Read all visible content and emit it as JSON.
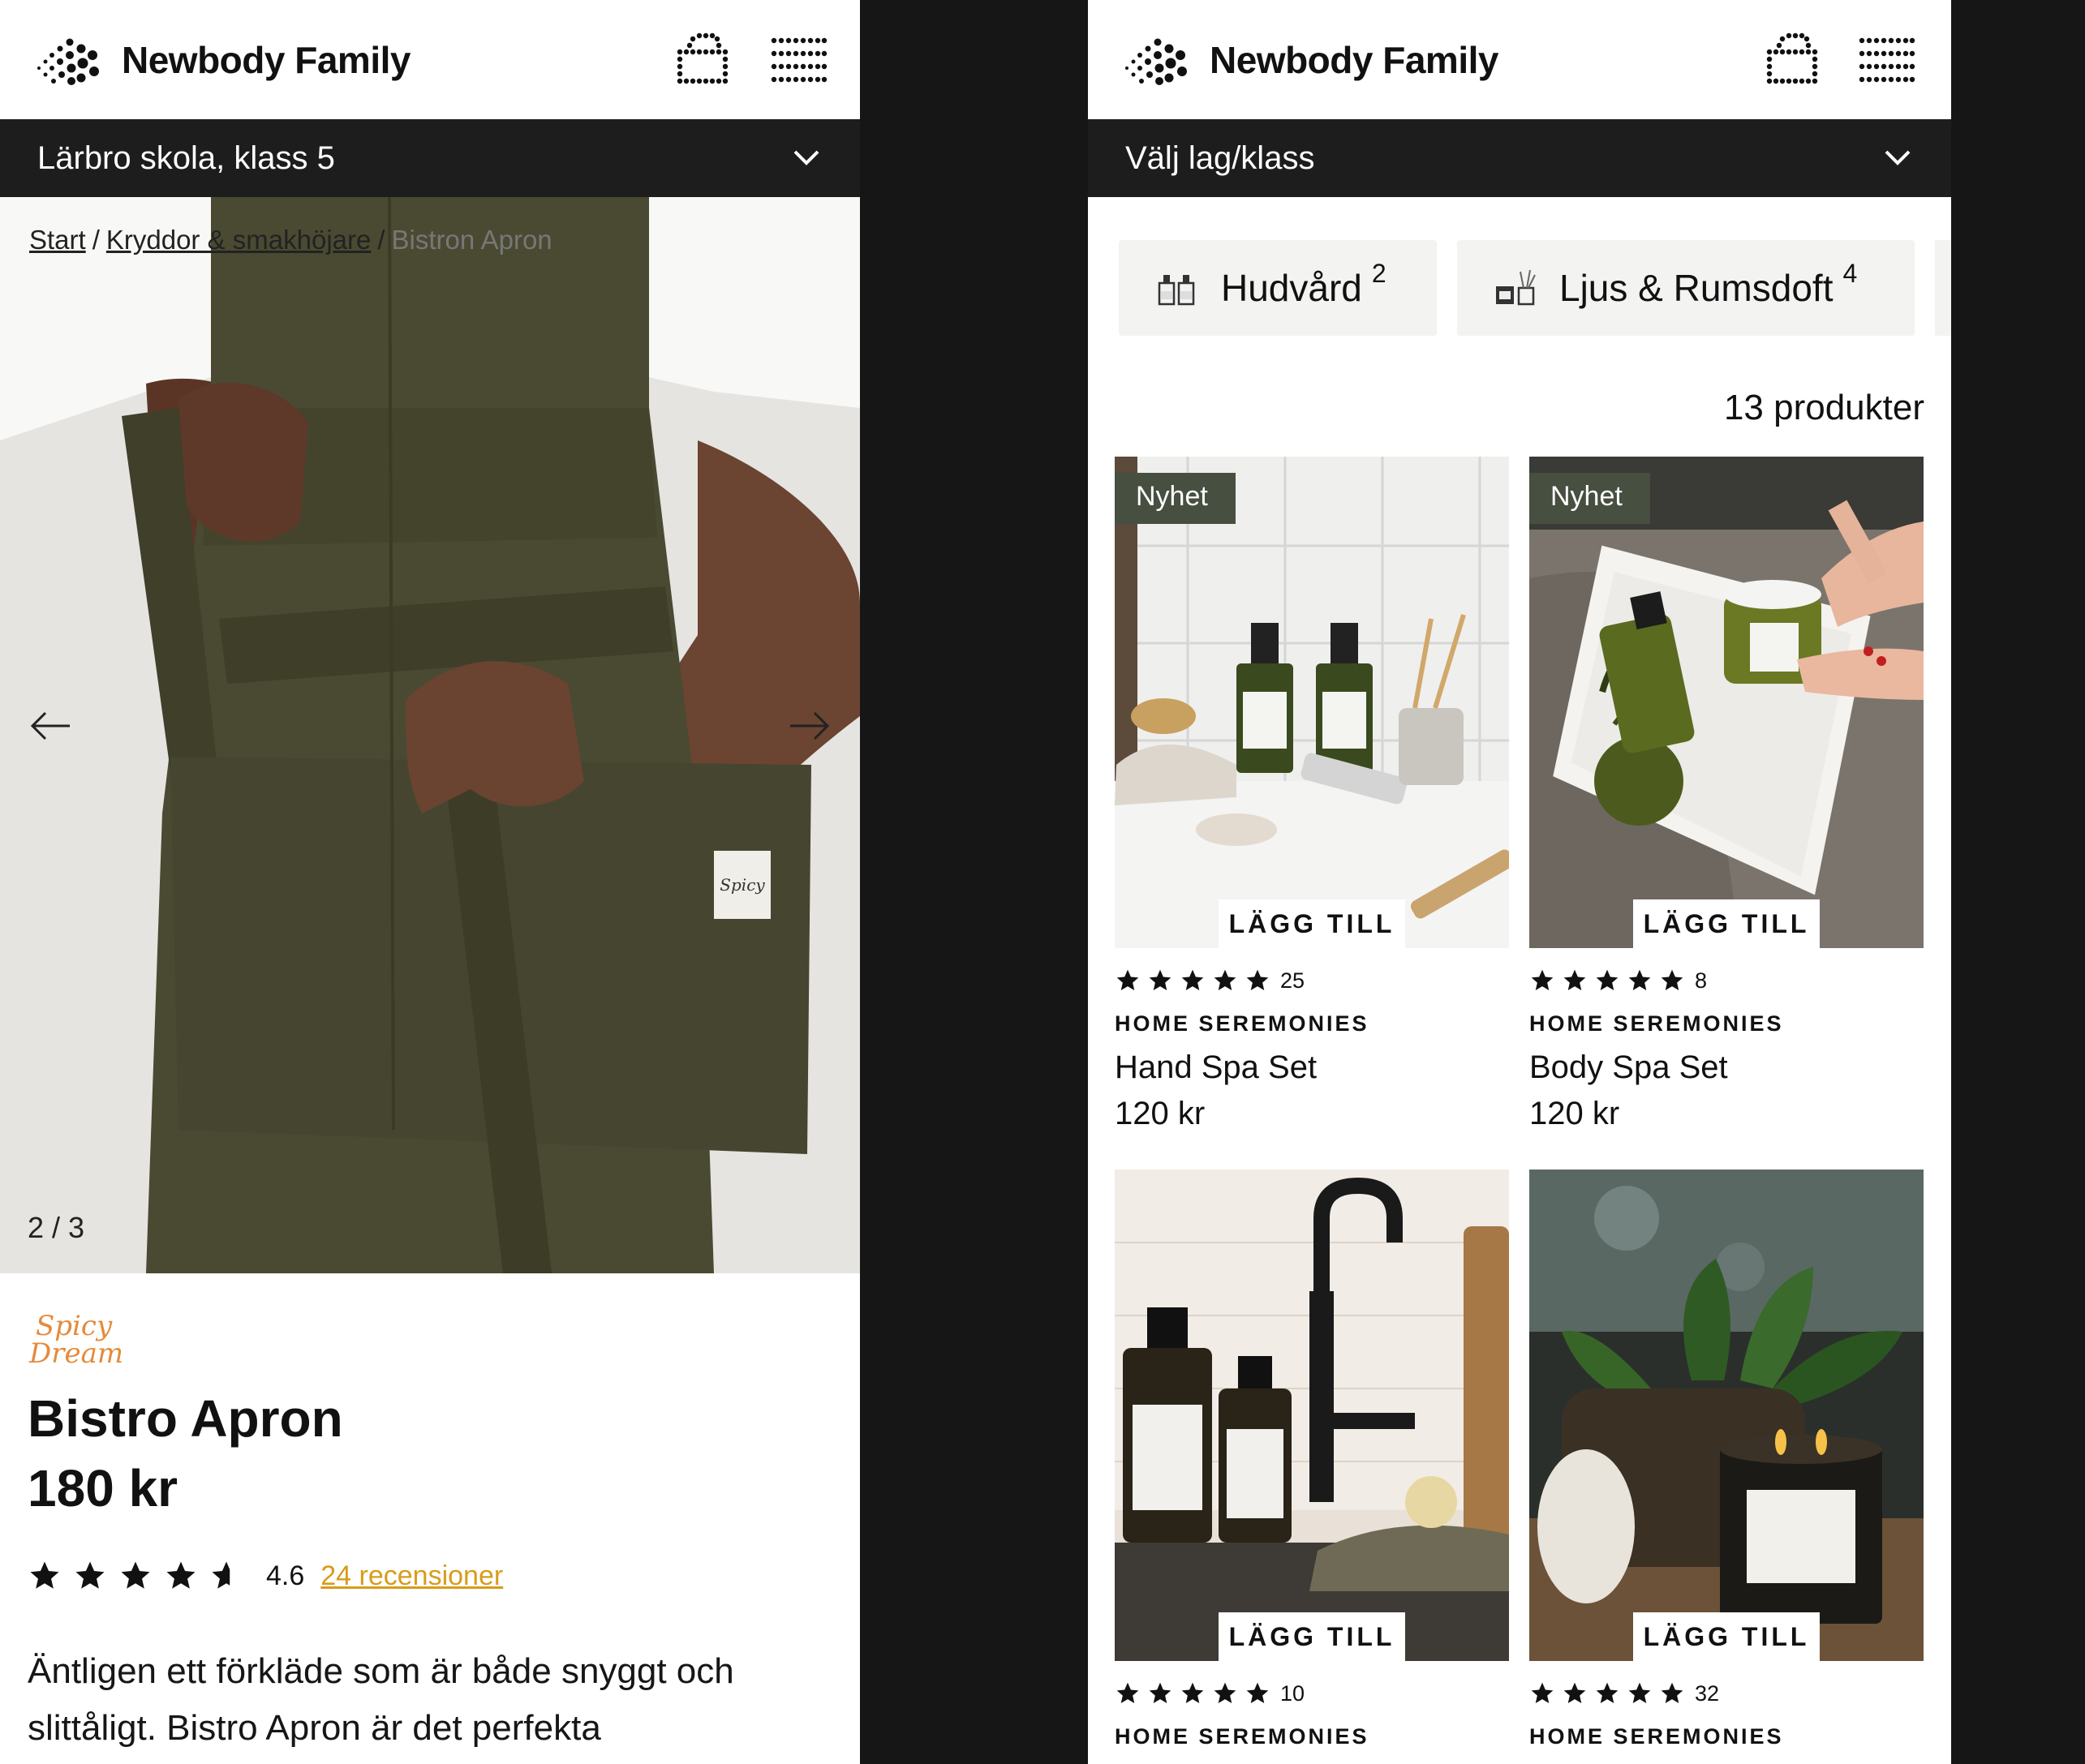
{
  "colors": {
    "background": "#161616",
    "selector_bar": "#1d1d1d",
    "review_link": "#d89c1a",
    "new_badge": "#474f40",
    "apron": "#4a4a32"
  },
  "left": {
    "brand": "Newbody Family",
    "team_selector": "Lärbro skola, klass 5",
    "breadcrumb": {
      "start": "Start",
      "category": "Kryddor & smakhöjare",
      "current": "Bistron Apron",
      "separator": "/"
    },
    "image_counter": "2 / 3",
    "product_brand_logo": "Spicy Dream",
    "product_name": "Bistro Apron",
    "price": "180 kr",
    "rating": {
      "value": "4.6",
      "stars": 4.6,
      "reviews_label": "24 recensioner"
    },
    "description": "Äntligen ett förkläde som är både snyggt och slittåligt. Bistro Apron är det perfekta"
  },
  "right": {
    "brand": "Newbody Family",
    "team_selector": "Välj lag/klass",
    "categories": [
      {
        "label": "Hudvård",
        "count": "2",
        "icon": "bottles-icon"
      },
      {
        "label": "Ljus & Rumsdoft",
        "count": "4",
        "icon": "candle-diffuser-icon"
      }
    ],
    "product_count": "13 produkter",
    "add_label": "LÄGG TILL",
    "badge_label": "Nyhet",
    "products": [
      {
        "badge": true,
        "stars": 5,
        "reviews": "25",
        "brand": "HOME SEREMONIES",
        "name": "Hand Spa Set",
        "price": "120 kr"
      },
      {
        "badge": true,
        "stars": 5,
        "reviews": "8",
        "brand": "HOME SEREMONIES",
        "name": "Body Spa Set",
        "price": "120 kr"
      },
      {
        "badge": false,
        "stars": 5,
        "reviews": "10",
        "brand": "HOME SEREMONIES",
        "name": "",
        "price": ""
      },
      {
        "badge": false,
        "stars": 5,
        "reviews": "32",
        "brand": "HOME SEREMONIES",
        "name": "",
        "price": ""
      }
    ]
  }
}
